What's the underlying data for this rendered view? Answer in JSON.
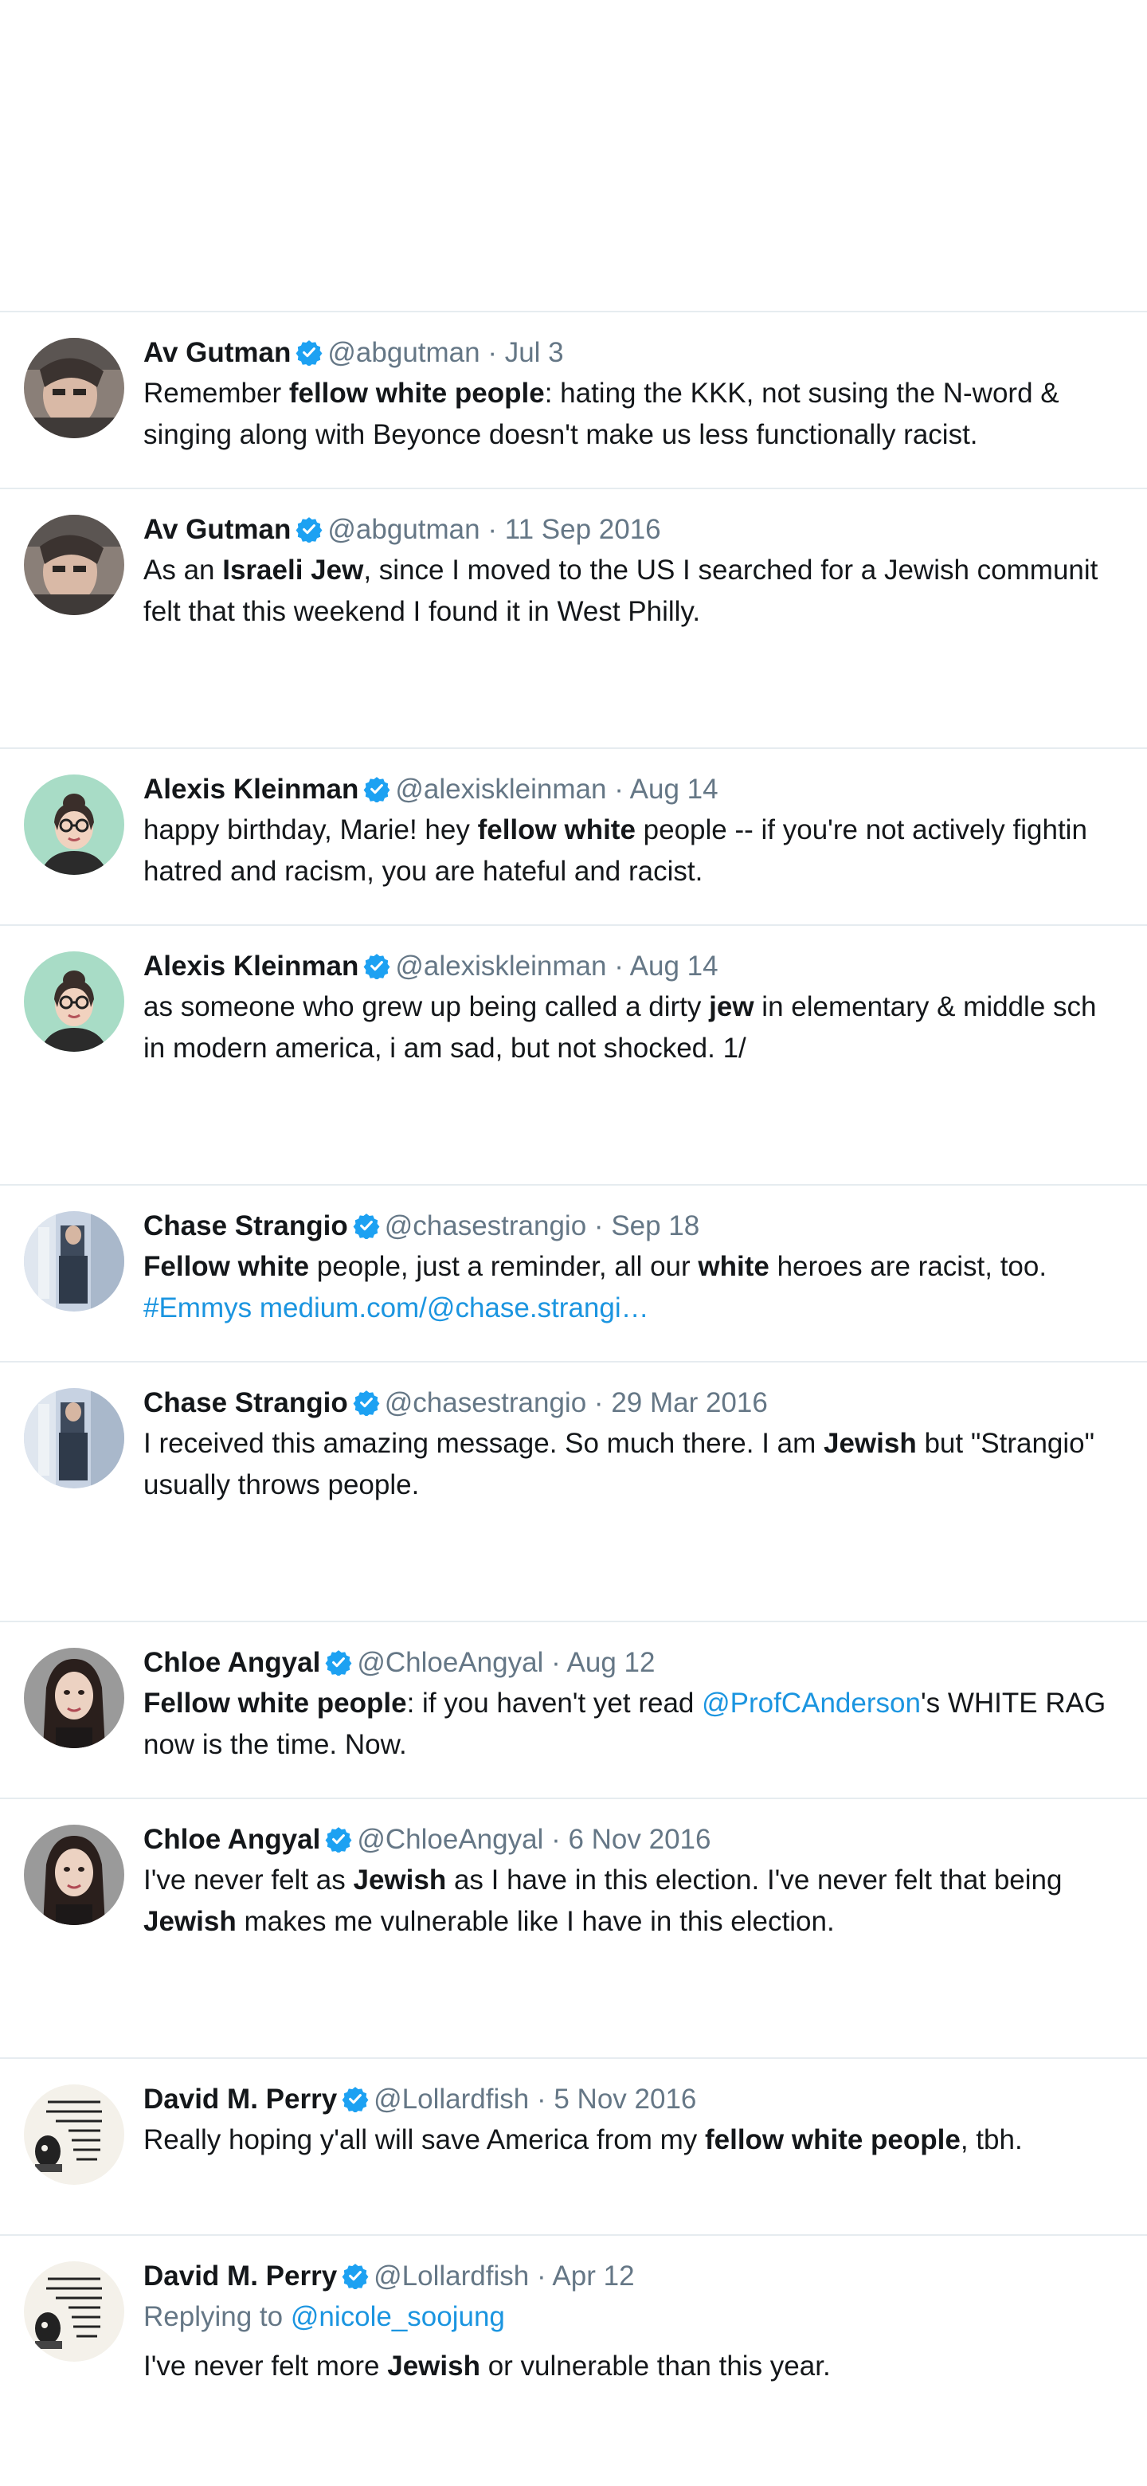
{
  "colors": {
    "link": "#1b95e0",
    "verified": "#1da1f2",
    "muted": "#657786",
    "divider": "#e6ecf0"
  },
  "icons": {
    "verified": "verified-badge-icon"
  },
  "tweets": [
    {
      "name": "Av Gutman",
      "handle": "@abgutman",
      "separator": "·",
      "date": "Jul 3",
      "line1": [
        {
          "text": "Remember ",
          "style": "normal"
        },
        {
          "text": "fellow white people",
          "style": "bold"
        },
        {
          "text": ": hating the KKK, not susing the N-word &",
          "style": "normal"
        }
      ],
      "line2": [
        {
          "text": "singing along with Beyonce doesn't make us less functionally racist.",
          "style": "normal"
        }
      ]
    },
    {
      "name": "Av Gutman",
      "handle": "@abgutman",
      "separator": "·",
      "date": "11 Sep 2016",
      "line1": [
        {
          "text": "As an ",
          "style": "normal"
        },
        {
          "text": "Israeli Jew",
          "style": "bold"
        },
        {
          "text": ", since I moved to the US I searched for a Jewish communit",
          "style": "normal"
        }
      ],
      "line2": [
        {
          "text": "felt that this weekend I found it in West Philly.",
          "style": "normal"
        }
      ]
    },
    {
      "name": "Alexis Kleinman",
      "handle": "@alexiskleinman",
      "separator": "·",
      "date": "Aug 14",
      "line1": [
        {
          "text": "happy birthday, Marie! hey ",
          "style": "normal"
        },
        {
          "text": "fellow white",
          "style": "bold"
        },
        {
          "text": " people -- if you're not actively fightin",
          "style": "normal"
        }
      ],
      "line2": [
        {
          "text": "hatred and racism, you are hateful and racist.",
          "style": "normal"
        }
      ]
    },
    {
      "name": "Alexis Kleinman",
      "handle": "@alexiskleinman",
      "separator": "·",
      "date": "Aug 14",
      "line1": [
        {
          "text": "as someone who grew up being called a dirty ",
          "style": "normal"
        },
        {
          "text": "jew",
          "style": "bold"
        },
        {
          "text": " in elementary & middle sch",
          "style": "normal"
        }
      ],
      "line2": [
        {
          "text": "in modern america, i am sad, but not shocked. 1/",
          "style": "normal"
        }
      ]
    },
    {
      "name": "Chase Strangio",
      "handle": "@chasestrangio",
      "separator": "·",
      "date": "Sep 18",
      "line1": [
        {
          "text": "Fellow white",
          "style": "bold"
        },
        {
          "text": " people, just a reminder, all our ",
          "style": "normal"
        },
        {
          "text": "white",
          "style": "bold"
        },
        {
          "text": " heroes are racist, too.",
          "style": "normal"
        }
      ],
      "line2": [
        {
          "text": "#Emmys",
          "style": "link"
        },
        {
          "text": " ",
          "style": "normal"
        },
        {
          "text": "medium.com/@chase.strangi…",
          "style": "link"
        }
      ]
    },
    {
      "name": "Chase Strangio",
      "handle": "@chasestrangio",
      "separator": "·",
      "date": "29 Mar 2016",
      "line1": [
        {
          "text": "I received this amazing message. So much there. I am ",
          "style": "normal"
        },
        {
          "text": "Jewish",
          "style": "bold"
        },
        {
          "text": " but \"Strangio\"",
          "style": "normal"
        }
      ],
      "line2": [
        {
          "text": "usually throws people.",
          "style": "normal"
        }
      ]
    },
    {
      "name": "Chloe Angyal",
      "handle": "@ChloeAngyal",
      "separator": "·",
      "date": "Aug 12",
      "line1": [
        {
          "text": "Fellow white people",
          "style": "bold"
        },
        {
          "text": ": if you haven't yet read ",
          "style": "normal"
        },
        {
          "text": "@ProfCAnderson",
          "style": "link"
        },
        {
          "text": "'s WHITE RAG",
          "style": "normal"
        }
      ],
      "line2": [
        {
          "text": "now is the time. Now.",
          "style": "normal"
        }
      ]
    },
    {
      "name": "Chloe Angyal",
      "handle": "@ChloeAngyal",
      "separator": "·",
      "date": "6 Nov 2016",
      "line1": [
        {
          "text": "I've never felt as ",
          "style": "normal"
        },
        {
          "text": "Jewish",
          "style": "bold"
        },
        {
          "text": " as I have in this election. I've never felt that being",
          "style": "normal"
        }
      ],
      "line2": [
        {
          "text": "Jewish",
          "style": "bold"
        },
        {
          "text": " makes me vulnerable like I have in this election.",
          "style": "normal"
        }
      ]
    },
    {
      "name": "David M. Perry",
      "handle": "@Lollardfish",
      "separator": "·",
      "date": "5 Nov 2016",
      "line1": [
        {
          "text": "Really hoping y'all will save America from my ",
          "style": "normal"
        },
        {
          "text": "fellow white people",
          "style": "bold"
        },
        {
          "text": ", tbh.",
          "style": "normal"
        }
      ],
      "line2": []
    },
    {
      "name": "David M. Perry",
      "handle": "@Lollardfish",
      "separator": "·",
      "date": "Apr 12",
      "reply_label": "Replying to",
      "reply_to": "@nicole_soojung",
      "line1": [
        {
          "text": "I've never felt more ",
          "style": "normal"
        },
        {
          "text": "Jewish",
          "style": "bold"
        },
        {
          "text": " or vulnerable than this year.",
          "style": "normal"
        }
      ],
      "line2": []
    }
  ]
}
